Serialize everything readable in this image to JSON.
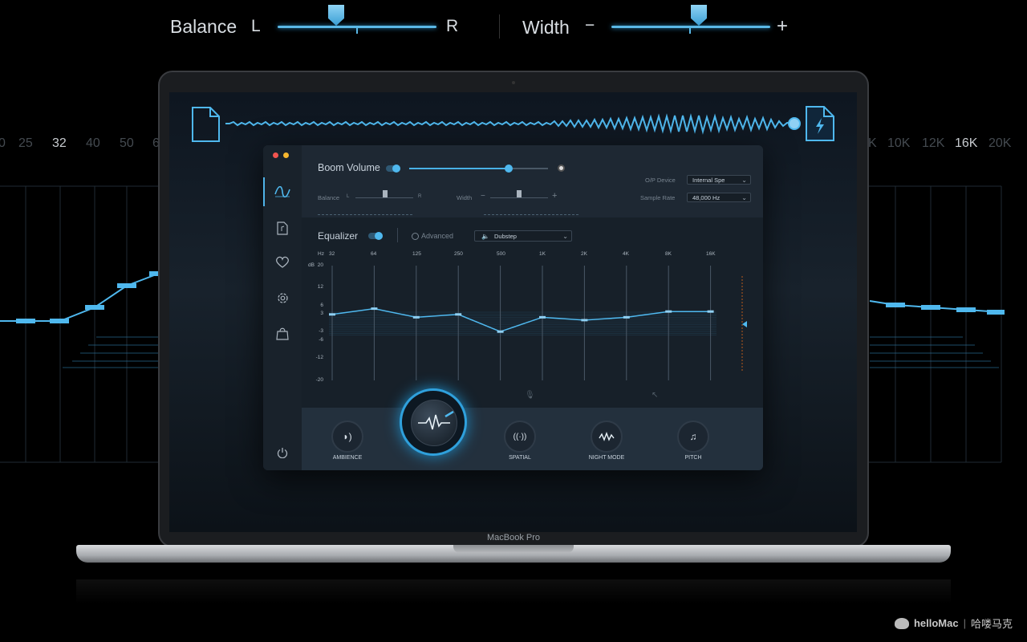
{
  "top_controls": {
    "balance": {
      "label": "Balance",
      "left": "L",
      "right": "R",
      "value": 0.4
    },
    "width": {
      "label": "Width",
      "minus": "−",
      "plus": "+",
      "value": 0.55
    }
  },
  "background_eq": {
    "freq_left": [
      "0",
      "25",
      "32",
      "40",
      "50",
      "6"
    ],
    "freq_right": [
      "K",
      "10K",
      "12K",
      "16K",
      "20K"
    ],
    "highlight": [
      "32",
      "16K"
    ]
  },
  "laptop": {
    "brand": "MacBook Pro"
  },
  "app": {
    "boom_volume": {
      "label": "Boom Volume",
      "value": 0.72
    },
    "balance": {
      "label": "Balance",
      "left": "L",
      "right": "R",
      "value": 0.5
    },
    "width": {
      "label": "Width",
      "minus": "−",
      "plus": "+",
      "value": 0.45
    },
    "op_device": {
      "label": "O/P Device",
      "value": "Internal Spe"
    },
    "sample_rate": {
      "label": "Sample Rate",
      "value": "48,000 Hz"
    },
    "equalizer": {
      "label": "Equalizer",
      "advanced_label": "Advanced",
      "preset": "Dubstep",
      "hz_label": "Hz",
      "db_label": "dB",
      "bands": [
        "32",
        "64",
        "125",
        "250",
        "500",
        "1K",
        "2K",
        "4K",
        "8K",
        "16K"
      ],
      "gains_db": [
        3,
        5,
        2,
        3,
        -3,
        2,
        1,
        2,
        4,
        4
      ],
      "db_ticks": [
        "20",
        "12",
        "6",
        "3",
        "-3",
        "-6",
        "-12",
        "-20"
      ]
    },
    "effects": [
      {
        "label": "AMBIENCE",
        "icon": "ambience-icon"
      },
      {
        "label": "SPATIAL",
        "icon": "spatial-icon"
      },
      {
        "label": "NIGHT MODE",
        "icon": "night-mode-icon"
      },
      {
        "label": "PITCH",
        "icon": "pitch-icon"
      }
    ]
  },
  "watermark": {
    "brand": "helloMac",
    "cn": "哈喽马克"
  },
  "colors": {
    "accent": "#4fb8ee",
    "bg": "#000000"
  }
}
